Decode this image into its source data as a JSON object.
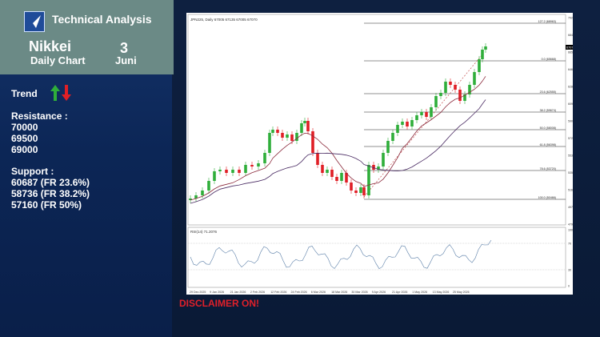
{
  "header": {
    "title": "Technical Analysis",
    "name": "Nikkei",
    "subtitle": "Daily Chart",
    "day": "3",
    "month": "Juni"
  },
  "sidebar": {
    "trend_label": "Trend",
    "resistance_title": "Resistance :",
    "resistance": [
      "70000",
      "69500",
      "69000"
    ],
    "support_title": "Support :",
    "support": [
      "60687 (FR 23.6%)",
      "58736 (FR 38.2%)",
      "57160 (FR 50%)"
    ]
  },
  "colors": {
    "up": "#2fae3a",
    "down": "#e01f26",
    "header_bg": "#6b8a86",
    "disclaimer": "#e0202a"
  },
  "chart": {
    "symbol_line": "JPN225, Daily  67005 67135 67005 67070",
    "last_price_label": "67070",
    "fib_labels": [
      "127.2 (68963)",
      "0.0 (65668)",
      "23.6 (62555)",
      "38.2 (59674)",
      "50.0 (58008)",
      "61.8 (56398)",
      "78.6 (53720)",
      "100.0 (50466)"
    ],
    "y_ticks": [
      "70299",
      "68429",
      "66559",
      "64689",
      "62819",
      "60949",
      "59079",
      "57209",
      "55339",
      "53524",
      "51654",
      "49784",
      "47914"
    ],
    "x_ticks": [
      "29 Dec 2025",
      "9 Jan 2026",
      "21 Jan 2026",
      "2 Feb 2026",
      "12 Feb 2026",
      "24 Feb 2026",
      "6 Mar 2026",
      "18 Mar 2026",
      "30 Mar 2026",
      "9 Apr 2026",
      "21 Apr 2026",
      "1 May 2026",
      "13 May 2026",
      "25 May 2026"
    ],
    "rsi_label": "RSI(14) 71.2076",
    "rsi_ticks": [
      "100",
      "70",
      "30",
      "0"
    ]
  },
  "disclaimer": "DISCLAIMER ON!"
}
